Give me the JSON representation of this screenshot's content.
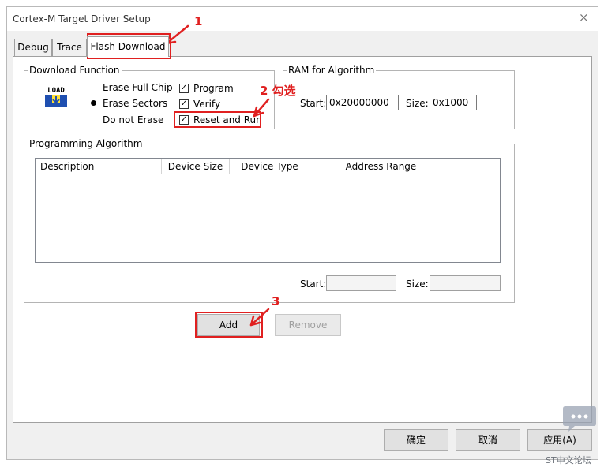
{
  "window": {
    "title": "Cortex-M Target Driver Setup",
    "close_glyph": "×"
  },
  "tabs": [
    {
      "label": "Debug"
    },
    {
      "label": "Trace"
    },
    {
      "label": "Flash Download",
      "active": true
    }
  ],
  "download_function": {
    "legend": "Download Function",
    "icon_text": "LOAD",
    "radios": [
      {
        "label": "Erase Full Chip",
        "selected": false
      },
      {
        "label": "Erase Sectors",
        "selected": true
      },
      {
        "label": "Do not Erase",
        "selected": false
      }
    ],
    "checkboxes": [
      {
        "label": "Program",
        "checked": true
      },
      {
        "label": "Verify",
        "checked": true
      },
      {
        "label": "Reset and Run",
        "checked": true
      }
    ],
    "check_glyph": "✓"
  },
  "ram": {
    "legend": "RAM for Algorithm",
    "start_label": "Start:",
    "start_value": "0x20000000",
    "size_label": "Size:",
    "size_value": "0x1000"
  },
  "algorithm": {
    "legend": "Programming Algorithm",
    "columns": [
      "Description",
      "Device Size",
      "Device Type",
      "Address Range"
    ],
    "rows": [],
    "start_label": "Start:",
    "start_value": "",
    "size_label": "Size:",
    "size_value": ""
  },
  "buttons": {
    "add": "Add",
    "remove": "Remove",
    "ok": "确定",
    "cancel": "取消",
    "apply": "应用(A)"
  },
  "annotations": {
    "one": "1",
    "two": "2 勾选",
    "three": "3",
    "color": "#e02020"
  },
  "watermark": {
    "text": "ST中文论坛"
  }
}
